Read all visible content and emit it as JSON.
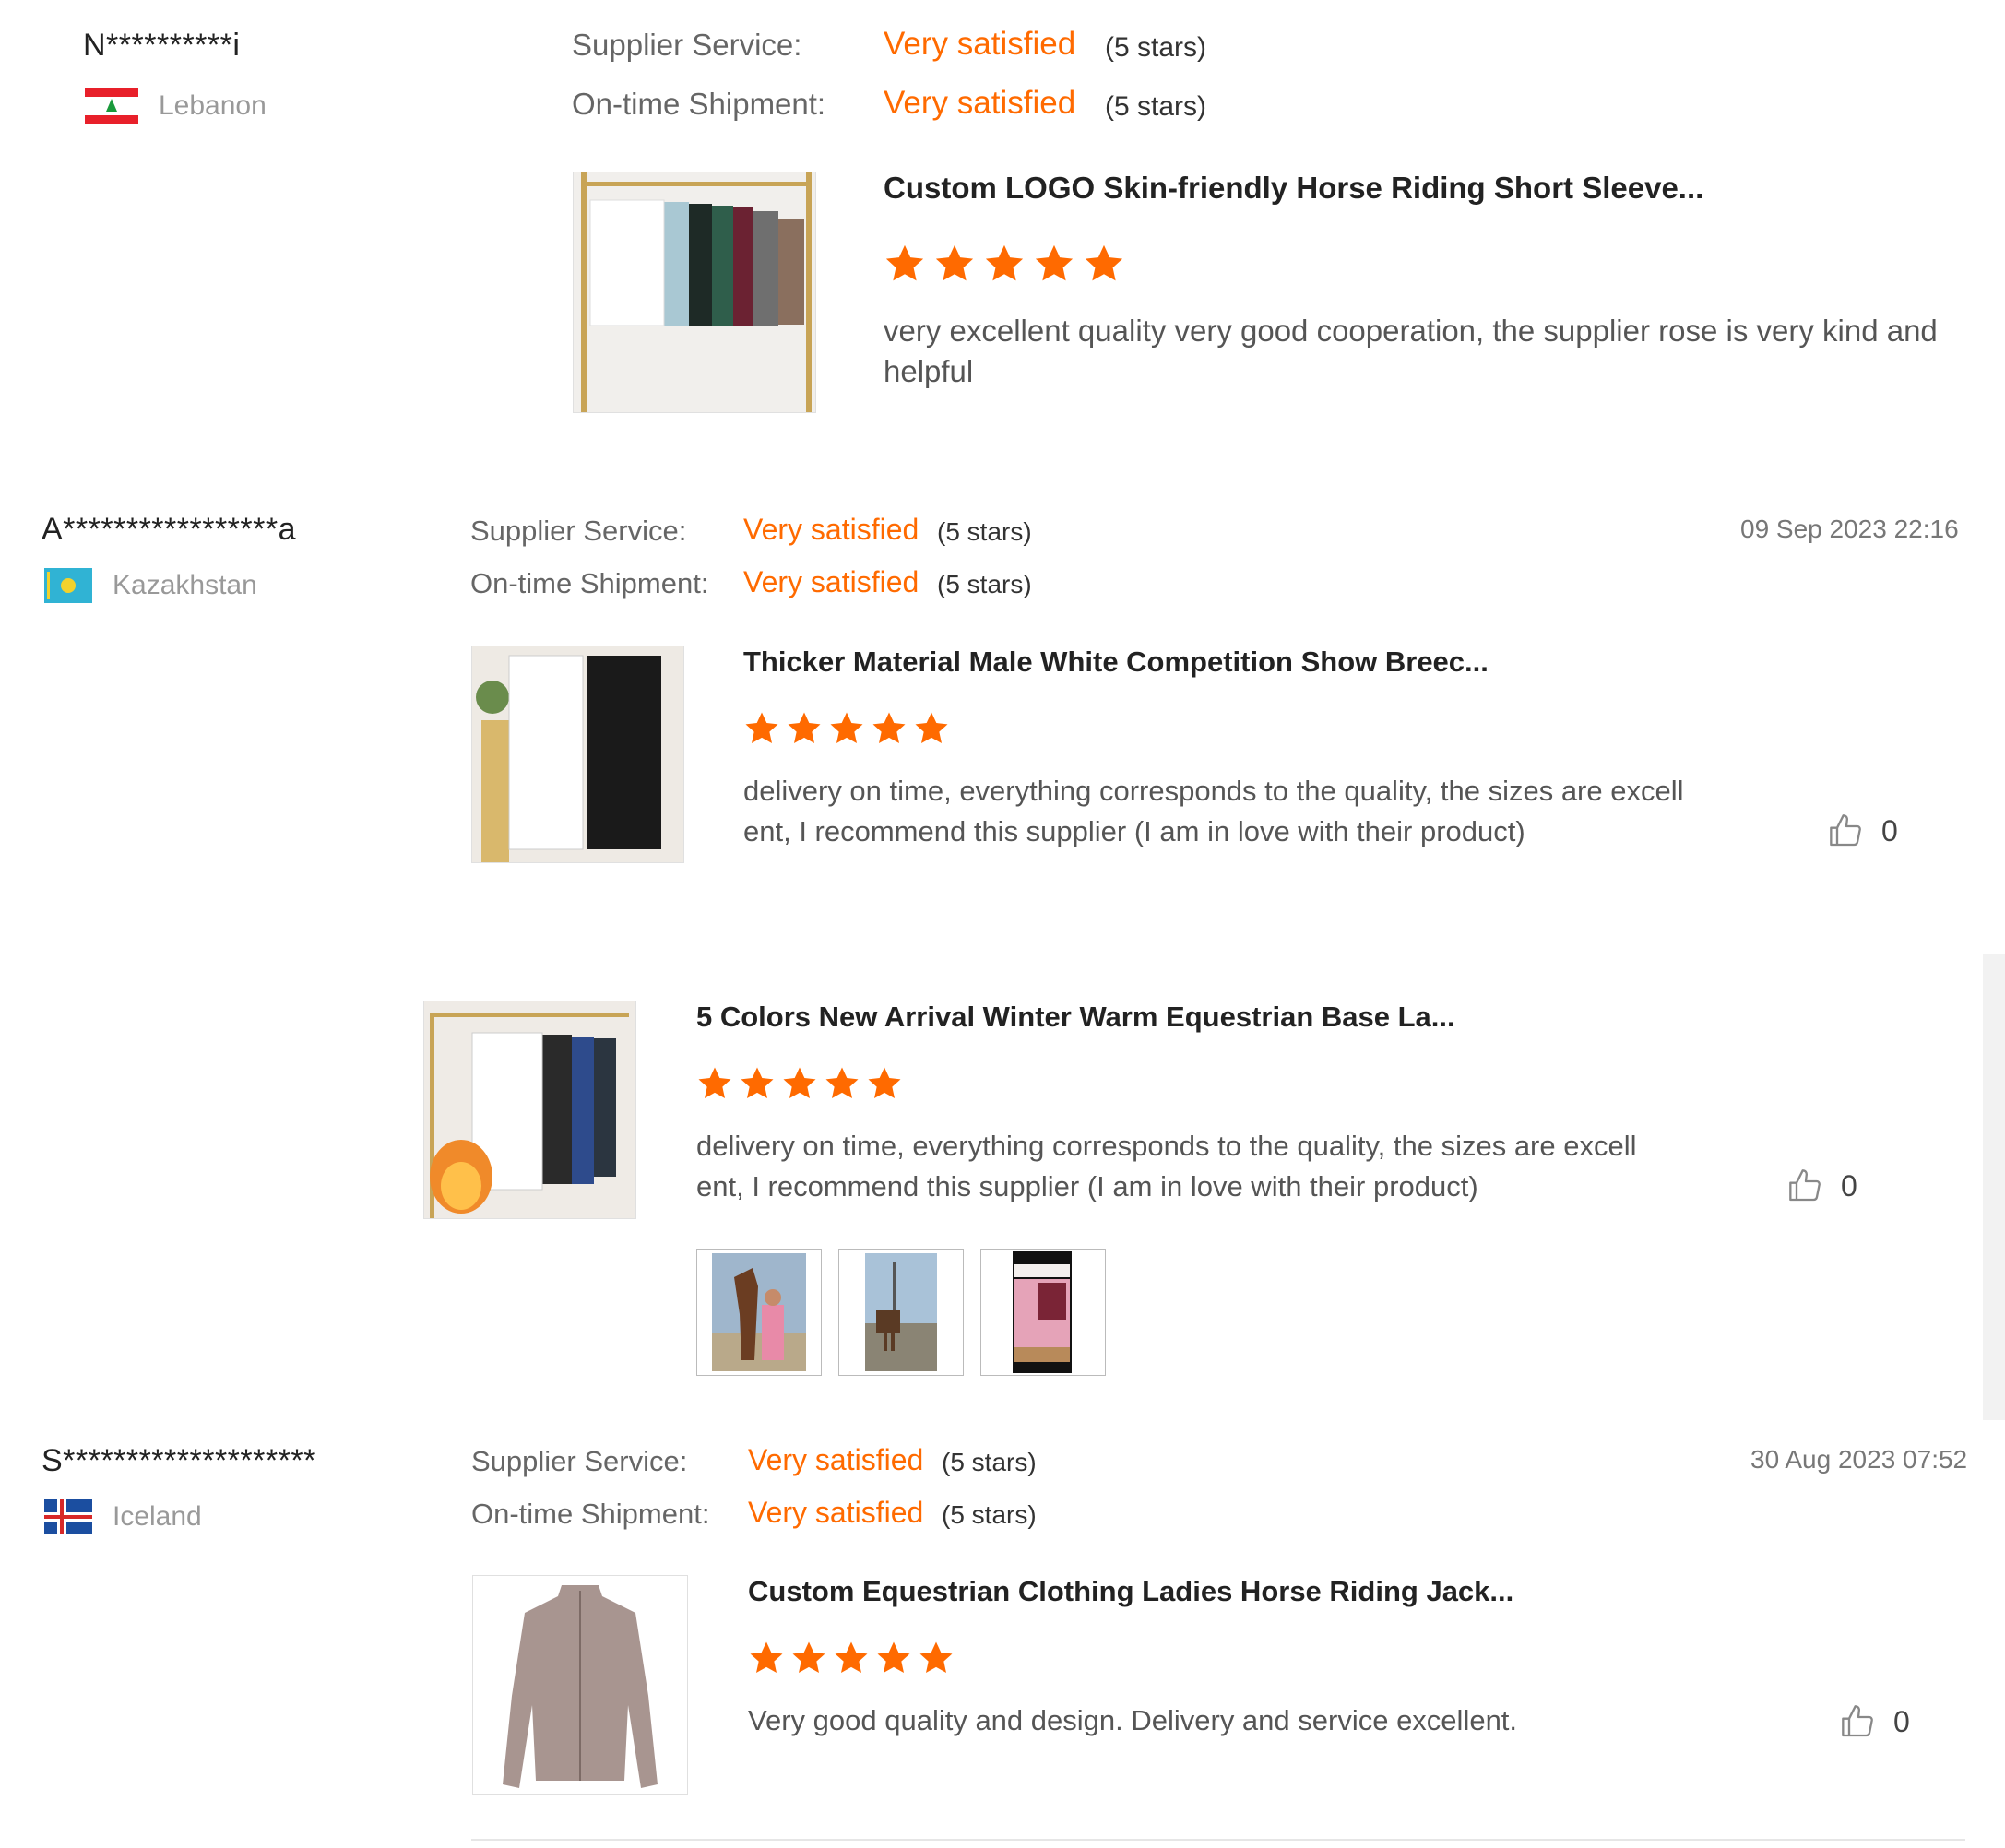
{
  "reviews": [
    {
      "name": "N**********i",
      "country": "Lebanon",
      "supplier_service_label": "Supplier Service:",
      "supplier_service_value": "Very satisfied",
      "supplier_service_stars": "(5 stars)",
      "shipment_label": "On-time Shipment:",
      "shipment_value": "Very satisfied",
      "shipment_stars": "(5 stars)",
      "product_title": "Custom LOGO Skin-friendly Horse Riding Short Sleeve...",
      "rating": 5,
      "comment": "very excellent quality very good cooperation, the supplier rose is very kind and helpful"
    },
    {
      "name": "A*****************a",
      "country": "Kazakhstan",
      "date": "09 Sep 2023 22:16",
      "supplier_service_label": "Supplier Service:",
      "supplier_service_value": "Very satisfied",
      "supplier_service_stars": "(5 stars)",
      "shipment_label": "On-time Shipment:",
      "shipment_value": "Very satisfied",
      "shipment_stars": "(5 stars)",
      "products": [
        {
          "title": "Thicker Material Male White Competition Show Breec...",
          "rating": 5,
          "comment_line1": "delivery on time, everything corresponds to the quality, the sizes are excell",
          "comment_line2": "ent, I recommend this supplier (I am in love with their product)",
          "likes": "0"
        },
        {
          "title": "5 Colors New Arrival Winter Warm Equestrian Base La...",
          "rating": 5,
          "comment_line1": "delivery on time, everything corresponds to the quality, the sizes are excell",
          "comment_line2": "ent, I recommend this supplier (I am in love with their product)",
          "likes": "0"
        }
      ]
    },
    {
      "name": "S********************",
      "country": "Iceland",
      "date": "30 Aug 2023 07:52",
      "supplier_service_label": "Supplier Service:",
      "supplier_service_value": "Very satisfied",
      "supplier_service_stars": "(5 stars)",
      "shipment_label": "On-time Shipment:",
      "shipment_value": "Very satisfied",
      "shipment_stars": "(5 stars)",
      "product_title": "Custom Equestrian Clothing Ladies Horse Riding Jack...",
      "rating": 5,
      "comment": "Very good quality and design. Delivery and service excellent.",
      "likes": "0"
    }
  ],
  "colors": {
    "accent": "#ff6a00",
    "text": "#333333",
    "muted": "#999999"
  },
  "icons": {
    "star": "star-icon",
    "like": "thumbs-up-icon"
  }
}
